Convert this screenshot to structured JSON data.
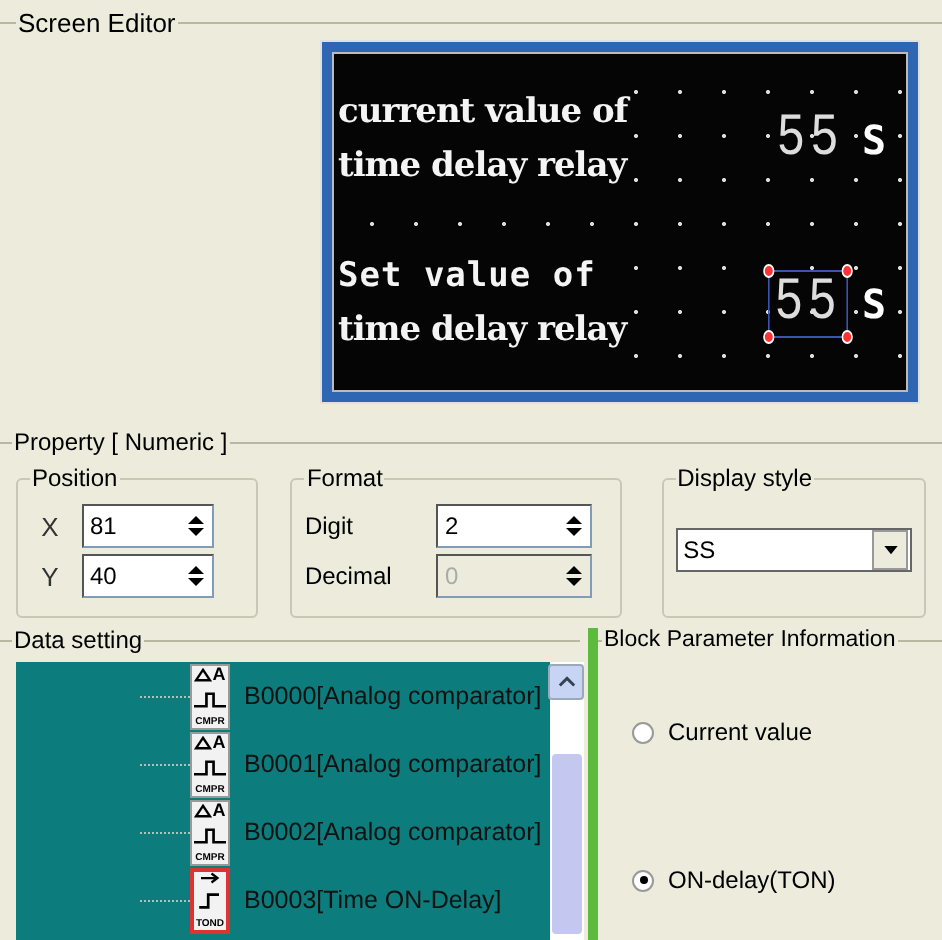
{
  "screen_editor": {
    "title": "Screen Editor",
    "lcd": {
      "rows": [
        {
          "label_lines": [
            "current value of",
            "time delay relay"
          ],
          "value": "55",
          "unit": "S",
          "selected": false
        },
        {
          "label_lines": [
            "Set value of",
            "time delay relay"
          ],
          "value": "55",
          "unit": "S",
          "selected": true
        }
      ]
    }
  },
  "property": {
    "title": "Property [ Numeric ]",
    "position": {
      "title": "Position",
      "fields": [
        {
          "label": "X",
          "value": "81"
        },
        {
          "label": "Y",
          "value": "40"
        }
      ]
    },
    "format": {
      "title": "Format",
      "fields": [
        {
          "label": "Digit",
          "value": "2",
          "disabled": false
        },
        {
          "label": "Decimal",
          "value": "0",
          "disabled": true
        }
      ]
    },
    "display_style": {
      "title": "Display style",
      "value": "SS"
    }
  },
  "data_setting": {
    "title": "Data setting",
    "items": [
      {
        "kind": "comparator",
        "icon_symbol": "A",
        "icon_label": "CMPR",
        "label": "B0000[Analog comparator]",
        "selected": false
      },
      {
        "kind": "comparator",
        "icon_symbol": "A",
        "icon_label": "CMPR",
        "label": "B0001[Analog comparator]",
        "selected": false
      },
      {
        "kind": "comparator",
        "icon_symbol": "A",
        "icon_label": "CMPR",
        "label": "B0002[Analog comparator]",
        "selected": false
      },
      {
        "kind": "timer",
        "icon_label": "TOND",
        "label": "B0003[Time ON-Delay]",
        "selected": true
      }
    ]
  },
  "block_parameter": {
    "title": "Block Parameter Information",
    "options": [
      {
        "label": "Current value",
        "selected": false
      },
      {
        "label": "ON-delay(TON)",
        "selected": true
      }
    ]
  }
}
